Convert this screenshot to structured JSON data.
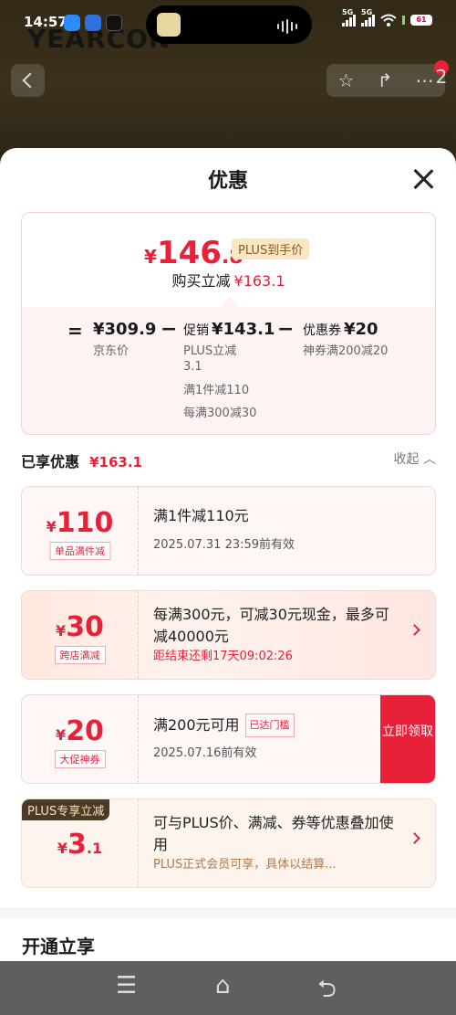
{
  "status_bar": {
    "time": "14:57",
    "signal_1": "5G",
    "signal_2": "5G",
    "battery": "61"
  },
  "background": {
    "logo_text": "YEARCON",
    "more_badge": "2"
  },
  "icons": {
    "back": "back-chevron-icon",
    "favorite": "star-icon",
    "share": "share-icon",
    "more": "more-dots-icon",
    "close": "close-icon",
    "collapse": "chevron-up-icon"
  },
  "sheet": {
    "title": "优惠",
    "summary": {
      "final_price_yen": "¥",
      "final_price_int": "146",
      "final_price_dec": ".8",
      "plus_tag": "PLUS到手价",
      "buy_reduce_label": "购买立减",
      "buy_reduce_amount": "¥163.1",
      "equals": "=",
      "minus_1": "−",
      "minus_2": "−",
      "jd_price": "¥309.9",
      "jd_price_label": "京东价",
      "promo_label": "促销",
      "promo_value": "¥143.1",
      "promo_line1": "PLUS立减",
      "promo_line1b": "3.1",
      "promo_line2": "满1件减110",
      "promo_line3": "每满300减30",
      "coupon_label": "优惠券",
      "coupon_value": "¥20",
      "coupon_sub": "神券满200减20"
    },
    "enjoyed": {
      "label": "已享优惠",
      "amount": "¥163.1",
      "collapse": "收起"
    },
    "coupons": [
      {
        "yen": "¥",
        "amount": "110",
        "decimal": "",
        "tag": "单品满件减",
        "desc": "满1件减110元",
        "time": "2025.07.31 23:59前有效"
      },
      {
        "yen": "¥",
        "amount": "30",
        "decimal": "",
        "tag": "跨店满减",
        "desc": "每满300元，可减30元现金，最多可减40000元",
        "time": "距结束还剩17天09:02:26"
      },
      {
        "yen": "¥",
        "amount": "20",
        "decimal": "",
        "tag": "大促神券",
        "desc": "满200元可用",
        "reach_tag": "已达门槛",
        "time": "2025.07.16前有效",
        "button": "立即领取"
      },
      {
        "corner": "PLUS专享立减",
        "yen": "¥",
        "amount": "3",
        "decimal": ".1",
        "desc": "可与PLUS价、满减、券等优惠叠加使用",
        "time": "PLUS正式会员可享，具体以结算..."
      }
    ],
    "open_enjoy": "开通立享"
  },
  "nav_bar": {
    "menu": "☰",
    "home": "⌂",
    "back": "⮌"
  },
  "colors": {
    "accent": "#e8203a",
    "plus_gold": "#fbe6c4",
    "plus_dark": "#4a3a28"
  }
}
